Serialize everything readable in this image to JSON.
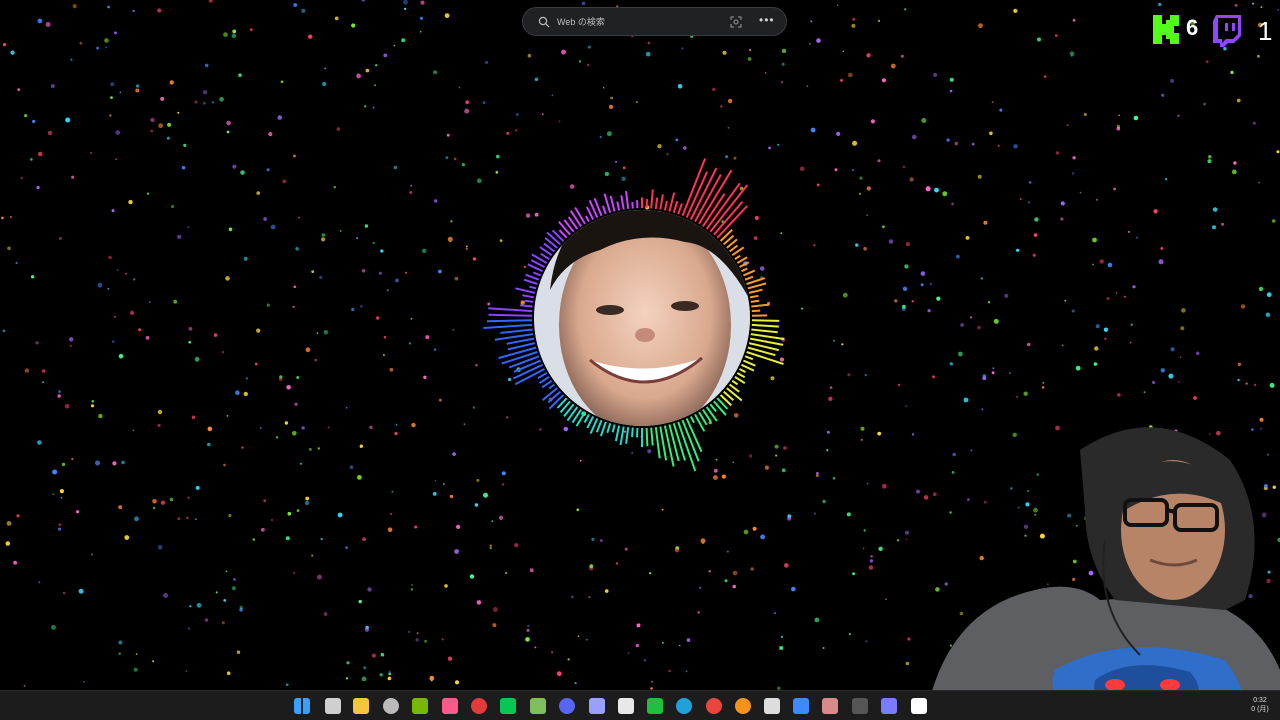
{
  "browser": {
    "search_placeholder": "Web の検索",
    "search_icon": "search-icon",
    "lens_icon": "visual-search-icon",
    "more_icon": "more-icon",
    "more_glyph": "•••"
  },
  "stream_overlay": {
    "kick": {
      "icon": "kick-logo-icon",
      "viewer_count": "6",
      "color": "#53fc18"
    },
    "twitch": {
      "icon": "twitch-logo-icon",
      "viewer_count": "1",
      "color": "#9146ff"
    }
  },
  "visualizer": {
    "type": "circular-audio-spectrum",
    "colors": [
      "#ff3355",
      "#ff9a22",
      "#e6ef3a",
      "#33ee77",
      "#22ddcc",
      "#3366ff",
      "#8844ff",
      "#cc44ff"
    ]
  },
  "taskbar": {
    "icons": [
      "windows-start-icon",
      "task-view-icon",
      "file-explorer-icon",
      "obs-icon",
      "nvidia-icon",
      "lips-app-icon",
      "record-icon",
      "line-icon",
      "vim-icon",
      "discord-icon",
      "vpn-icon",
      "notepad-icon",
      "xbox-icon",
      "edge-icon",
      "chrome-icon",
      "bitcoin-icon",
      "g-hub-icon",
      "app-icon",
      "photos-icon",
      "tray-app-icon",
      "tray-app-icon-2",
      "capcut-icon"
    ],
    "clock_time": "0:32",
    "clock_date": "0 (月)"
  }
}
